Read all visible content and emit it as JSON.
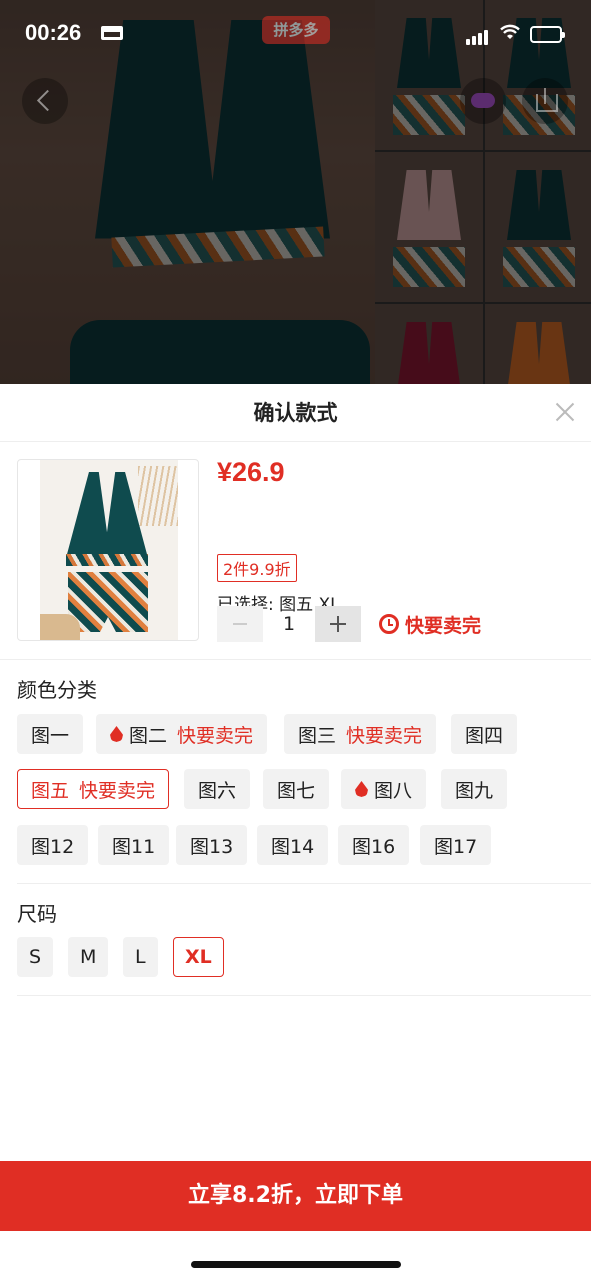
{
  "status_bar": {
    "time": "00:26"
  },
  "background": {
    "logo_text": "拼多多"
  },
  "sheet": {
    "title": "确认款式",
    "product": {
      "price": "¥26.9",
      "discount": "2件9.9折",
      "selected": "已选择: 图五 XL",
      "quantity": "1",
      "hurry_label": "快要卖完"
    },
    "color_section": {
      "title": "颜色分类",
      "options": [
        {
          "label": "图一",
          "hot": "",
          "fire": false,
          "selected": false
        },
        {
          "label": "图二",
          "hot": "快要卖完",
          "fire": true,
          "selected": false
        },
        {
          "label": "图三",
          "hot": "快要卖完",
          "fire": false,
          "selected": false
        },
        {
          "label": "图四",
          "hot": "",
          "fire": false,
          "selected": false
        },
        {
          "label": "图五",
          "hot": "快要卖完",
          "fire": false,
          "selected": true
        },
        {
          "label": "图六",
          "hot": "",
          "fire": false,
          "selected": false
        },
        {
          "label": "图七",
          "hot": "",
          "fire": false,
          "selected": false
        },
        {
          "label": "图八",
          "hot": "",
          "fire": true,
          "selected": false
        },
        {
          "label": "图九",
          "hot": "",
          "fire": false,
          "selected": false
        },
        {
          "label": "图12",
          "hot": "",
          "fire": false,
          "selected": false
        },
        {
          "label": "图11",
          "hot": "",
          "fire": false,
          "selected": false
        },
        {
          "label": "图13",
          "hot": "",
          "fire": false,
          "selected": false
        },
        {
          "label": "图14",
          "hot": "",
          "fire": false,
          "selected": false
        },
        {
          "label": "图16",
          "hot": "",
          "fire": false,
          "selected": false
        },
        {
          "label": "图17",
          "hot": "",
          "fire": false,
          "selected": false
        }
      ]
    },
    "size_section": {
      "title": "尺码",
      "options": [
        {
          "label": "S",
          "selected": false
        },
        {
          "label": "M",
          "selected": false
        },
        {
          "label": "L",
          "selected": false
        },
        {
          "label": "XL",
          "selected": true
        }
      ]
    },
    "buy_button": "立享8.2折，立即下单"
  },
  "colors": {
    "accent": "#e02e24",
    "chip_bg": "#f2f2f2"
  }
}
